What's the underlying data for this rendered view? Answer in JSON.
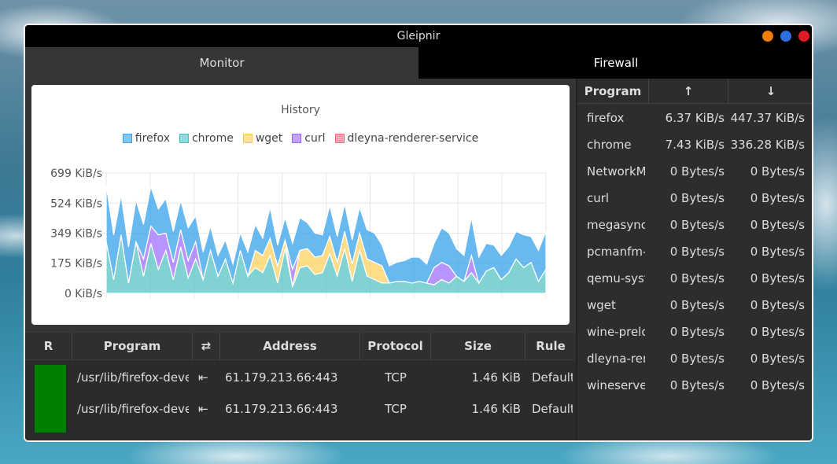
{
  "window": {
    "title": "Gleipnir",
    "buttons": [
      {
        "name": "minimize",
        "color": "#f07c00"
      },
      {
        "name": "maximize",
        "color": "#2d6fe0"
      },
      {
        "name": "close",
        "color": "#e01b24"
      }
    ]
  },
  "tabs": [
    {
      "label": "Monitor",
      "active": true
    },
    {
      "label": "Firewall",
      "active": false
    }
  ],
  "chart_data": {
    "type": "area",
    "title": "History",
    "legend_position": "top",
    "grid": true,
    "ylim": [
      0,
      699
    ],
    "y_tick_labels": [
      "699 KiB/s",
      "524 KiB/s",
      "349 KiB/s",
      "175 KiB/s",
      "0 KiB/s"
    ],
    "y_tick_values": [
      699,
      524,
      349,
      175,
      0
    ],
    "stacked": true,
    "n_points": 60,
    "series": [
      {
        "name": "firefox",
        "color": "#36a2eb",
        "values": [
          330,
          260,
          230,
          210,
          240,
          200,
          230,
          150,
          200,
          180,
          170,
          190,
          150,
          160,
          140,
          120,
          110,
          110,
          100,
          140,
          150,
          100,
          180,
          120,
          130,
          150,
          190,
          150,
          140,
          120,
          180,
          150,
          160,
          140,
          150,
          170,
          170,
          120,
          100,
          110,
          120,
          150,
          140,
          110,
          140,
          200,
          190,
          160,
          150,
          220,
          150,
          160,
          130,
          140,
          150,
          160,
          190,
          150,
          180,
          220
        ]
      },
      {
        "name": "chrome",
        "color": "#4bc0c0",
        "values": [
          300,
          80,
          340,
          60,
          300,
          100,
          290,
          140,
          250,
          80,
          270,
          90,
          200,
          80,
          250,
          100,
          200,
          60,
          250,
          100,
          150,
          120,
          220,
          60,
          260,
          40,
          150,
          160,
          110,
          120,
          230,
          100,
          260,
          70,
          250,
          100,
          80,
          60,
          60,
          70,
          70,
          60,
          70,
          60,
          50,
          80,
          60,
          100,
          70,
          120,
          60,
          130,
          150,
          80,
          120,
          200,
          150,
          180,
          70,
          140
        ]
      },
      {
        "name": "wget",
        "color": "#ffcd56",
        "values": [
          0,
          0,
          0,
          0,
          0,
          0,
          0,
          0,
          0,
          0,
          0,
          0,
          0,
          0,
          0,
          0,
          0,
          0,
          0,
          0,
          100,
          100,
          100,
          100,
          50,
          0,
          100,
          100,
          100,
          100,
          100,
          80,
          100,
          100,
          100,
          100,
          100,
          100,
          0,
          0,
          0,
          0,
          0,
          0,
          0,
          0,
          0,
          0,
          0,
          0,
          0,
          0,
          0,
          0,
          0,
          0,
          0,
          0,
          0,
          0
        ]
      },
      {
        "name": "curl",
        "color": "#9966ff",
        "values": [
          0,
          0,
          0,
          0,
          0,
          100,
          100,
          200,
          100,
          100,
          100,
          100,
          100,
          0,
          0,
          0,
          0,
          0,
          0,
          0,
          0,
          0,
          0,
          0,
          0,
          100,
          0,
          0,
          0,
          0,
          0,
          0,
          0,
          0,
          0,
          0,
          0,
          0,
          0,
          0,
          0,
          0,
          0,
          0,
          100,
          100,
          100,
          0,
          0,
          100,
          0,
          0,
          0,
          0,
          0,
          0,
          0,
          0,
          0,
          0
        ]
      },
      {
        "name": "dleyna-renderer-service",
        "color": "#ff6384",
        "values": [
          0,
          0,
          0,
          0,
          0,
          0,
          0,
          0,
          0,
          0,
          0,
          0,
          0,
          0,
          0,
          0,
          0,
          0,
          0,
          0,
          0,
          0,
          0,
          0,
          0,
          0,
          0,
          0,
          0,
          0,
          0,
          0,
          0,
          0,
          0,
          0,
          0,
          0,
          0,
          0,
          0,
          0,
          0,
          0,
          0,
          0,
          0,
          0,
          0,
          0,
          0,
          0,
          0,
          0,
          0,
          0,
          0,
          0,
          0,
          0
        ]
      }
    ]
  },
  "connections": {
    "headers": [
      "R",
      "Program",
      "⇄",
      "Address",
      "Protocol",
      "Size",
      "Rule"
    ],
    "rows": [
      {
        "program": "/usr/lib/firefox-deve",
        "direction": "⇤",
        "address": "61.179.213.66:443",
        "protocol": "TCP",
        "size": "1.46 KiB",
        "rule": "Default"
      },
      {
        "program": "/usr/lib/firefox-deve",
        "direction": "⇤",
        "address": "61.179.213.66:443",
        "protocol": "TCP",
        "size": "1.46 KiB",
        "rule": "Default"
      }
    ],
    "status_color": "#008000"
  },
  "bandwidth": {
    "headers": [
      "Program",
      "↑",
      "↓"
    ],
    "rows": [
      {
        "program": "firefox",
        "up": "6.37 KiB/s",
        "down": "447.37 KiB/s"
      },
      {
        "program": "chrome",
        "up": "7.43 KiB/s",
        "down": "336.28 KiB/s"
      },
      {
        "program": "NetworkManager",
        "up": "0 Bytes/s",
        "down": "0 Bytes/s"
      },
      {
        "program": "curl",
        "up": "0 Bytes/s",
        "down": "0 Bytes/s"
      },
      {
        "program": "megasync",
        "up": "0 Bytes/s",
        "down": "0 Bytes/s"
      },
      {
        "program": "pcmanfm-qt",
        "up": "0 Bytes/s",
        "down": "0 Bytes/s"
      },
      {
        "program": "qemu-system",
        "up": "0 Bytes/s",
        "down": "0 Bytes/s"
      },
      {
        "program": "wget",
        "up": "0 Bytes/s",
        "down": "0 Bytes/s"
      },
      {
        "program": "wine-preloader",
        "up": "0 Bytes/s",
        "down": "0 Bytes/s"
      },
      {
        "program": "dleyna-renderer-service",
        "up": "0 Bytes/s",
        "down": "0 Bytes/s"
      },
      {
        "program": "wineserver",
        "up": "0 Bytes/s",
        "down": "0 Bytes/s"
      }
    ]
  }
}
